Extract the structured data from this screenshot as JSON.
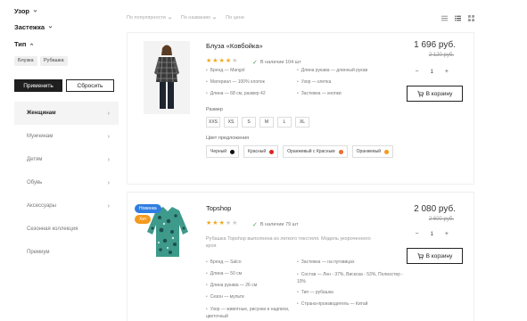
{
  "filters": {
    "pattern": "Узор",
    "clasp": "Застежка",
    "type": "Тип",
    "tags": [
      "Блузка",
      "Рубашка"
    ],
    "apply": "Применить",
    "reset": "Сбросить"
  },
  "categories": [
    {
      "label": "Женщинам",
      "arrow": "›"
    },
    {
      "label": "Мужчинам",
      "arrow": "›"
    },
    {
      "label": "Детям",
      "arrow": "›"
    },
    {
      "label": "Обувь",
      "arrow": "›"
    },
    {
      "label": "Аксессуары",
      "arrow": "›"
    },
    {
      "label": "Сезонная коллекция",
      "arrow": ""
    },
    {
      "label": "Премиум",
      "arrow": ""
    }
  ],
  "sort": {
    "popularity": "По популярности",
    "name": "По названию",
    "price": "По цене"
  },
  "colors": {
    "star": "#f2a81d",
    "stock_check": "#3aa757",
    "badge_new": "#2f7de1",
    "badge_hit": "#f39a1e"
  },
  "products": [
    {
      "name": "Блуза «Ковбойка»",
      "rating": 4,
      "stock": "В наличии 104 шт",
      "props_left": [
        "Бренд — Mangol",
        "Материал — 100% хлопок",
        "Длина — 68 см, размер 42"
      ],
      "props_right": [
        "Длина рукава — длинный рукав",
        "Узор — клетка",
        "Застежка — кнопки"
      ],
      "price": "1 696 руб.",
      "old_price": "2 120 руб.",
      "qty": "1",
      "minus": "−",
      "plus": "+",
      "cart": "В корзину",
      "size_label": "Размер",
      "sizes": [
        "XXS",
        "XS",
        "S",
        "M",
        "L",
        "XL"
      ],
      "color_label": "Цвет предложения",
      "color_options": [
        {
          "label": "Черный",
          "hex": "#111111"
        },
        {
          "label": "Красный",
          "hex": "#d92525"
        },
        {
          "label": "Оранжевый с Красным",
          "hex": "#ef6a2e"
        },
        {
          "label": "Оранжевый",
          "hex": "#f39a1e"
        }
      ]
    },
    {
      "name": "Topshop",
      "badge_new": "Новинка",
      "badge_hit": "Хит",
      "rating": 3,
      "stock": "В наличии 79 шт",
      "description": "Рубашка Topshop выполнена из легкого текстиля. Модель укороченного кроя",
      "props_left": [
        "Бренд — Salco",
        "Длина — 50 см",
        "Длина рукава — 26 см",
        "Сезон — мульти",
        "Узор — животные, рисунки и надписи, цветочный"
      ],
      "props_right": [
        "Застежка — на пуговицах",
        "Состав — Лен - 37%, Вискоза - 53%, Полиэстер - 10%",
        "Тип — рубашка",
        "Страна-производитель — Китай"
      ],
      "price": "2 080 руб.",
      "old_price": "2 600 руб.",
      "qty": "1",
      "minus": "−",
      "plus": "+",
      "cart": "В корзину"
    }
  ]
}
